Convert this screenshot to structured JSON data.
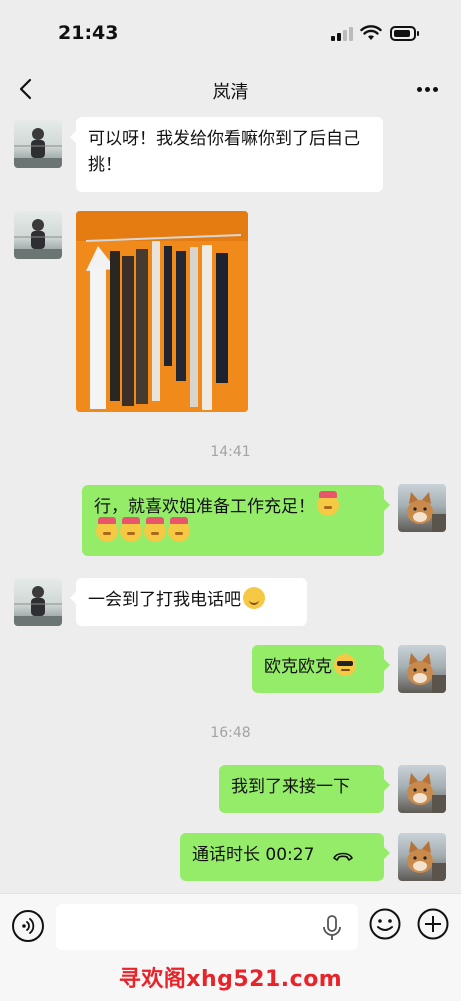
{
  "status_bar": {
    "time": "21:43"
  },
  "header": {
    "title": "岚清"
  },
  "messages": [
    {
      "side": "left",
      "text": "可以呀！我发给你看嘛你到了后自己挑！"
    },
    {
      "side": "left",
      "type": "image"
    },
    {
      "type": "timestamp",
      "text": "14:41"
    },
    {
      "side": "right",
      "text": "行，就喜欢姐准备工作充足！"
    },
    {
      "side": "left",
      "text": "一会到了打我电话吧"
    },
    {
      "side": "right",
      "text": "欧克欧克"
    },
    {
      "type": "timestamp",
      "text": "16:48"
    },
    {
      "side": "right",
      "text": "我到了来接一下"
    },
    {
      "side": "right",
      "type": "call",
      "text": "通话时长 00:27"
    }
  ],
  "watermark": "寻欢阁xhg521.com",
  "colors": {
    "bubble_self": "#95ec69",
    "bubble_other": "#ffffff",
    "background": "#ededed"
  },
  "icons": [
    "back-icon",
    "more-icon",
    "voice-icon",
    "mic-icon",
    "emoji-icon",
    "plus-icon",
    "phone-end-icon"
  ]
}
